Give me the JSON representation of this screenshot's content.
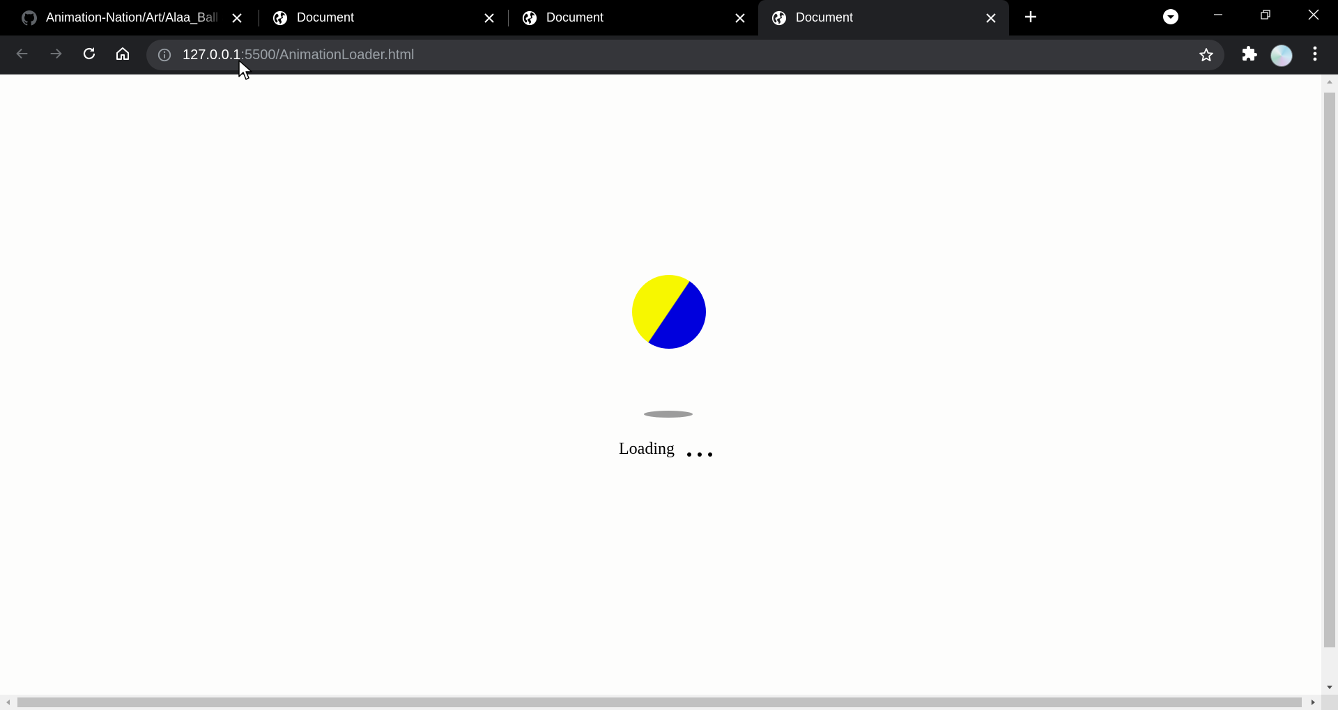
{
  "tabs": [
    {
      "title": "Animation-Nation/Art/Alaa_Ball a",
      "favicon": "github-icon",
      "active": false
    },
    {
      "title": "Document",
      "favicon": "globe-icon",
      "active": false
    },
    {
      "title": "Document",
      "favicon": "globe-icon",
      "active": false
    },
    {
      "title": "Document",
      "favicon": "globe-icon",
      "active": true
    }
  ],
  "address_bar": {
    "host": "127.0.0.1",
    "rest": ":5500/AnimationLoader.html"
  },
  "page": {
    "loading_text": "Loading",
    "dots_count": 3,
    "ball_colors": [
      "#f7f700",
      "#0000dd"
    ]
  },
  "icons": {
    "back": "arrow-left-icon",
    "forward": "arrow-right-icon",
    "reload": "reload-icon",
    "home": "home-icon",
    "info": "info-icon",
    "bookmark": "star-icon",
    "extensions": "puzzle-icon",
    "menu": "kebab-menu-icon"
  }
}
